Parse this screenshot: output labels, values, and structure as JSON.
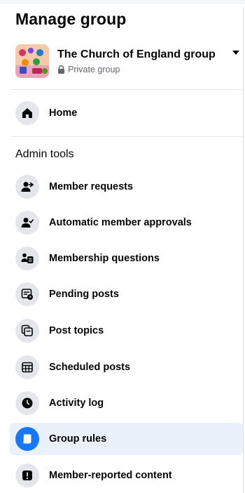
{
  "page": {
    "title": "Manage group"
  },
  "group": {
    "name": "The Church of England group",
    "privacy": "Private group"
  },
  "nav": {
    "home": {
      "label": "Home",
      "icon": "home-icon"
    }
  },
  "admin_tools": {
    "header": "Admin tools",
    "items": [
      {
        "label": "Member requests",
        "icon": "member-requests-icon"
      },
      {
        "label": "Automatic member approvals",
        "icon": "automatic-approvals-icon"
      },
      {
        "label": "Membership questions",
        "icon": "membership-questions-icon"
      },
      {
        "label": "Pending posts",
        "icon": "pending-posts-icon"
      },
      {
        "label": "Post topics",
        "icon": "post-topics-icon"
      },
      {
        "label": "Scheduled posts",
        "icon": "scheduled-posts-icon"
      },
      {
        "label": "Activity log",
        "icon": "clock-icon"
      },
      {
        "label": "Group rules",
        "icon": "group-rules-icon",
        "active": true
      },
      {
        "label": "Member-reported content",
        "icon": "report-icon"
      }
    ]
  },
  "colors": {
    "accent": "#1877f2",
    "active_bg": "#ebf1fb",
    "icon_bg": "#e4e6eb",
    "secondary_text": "#65676b"
  }
}
